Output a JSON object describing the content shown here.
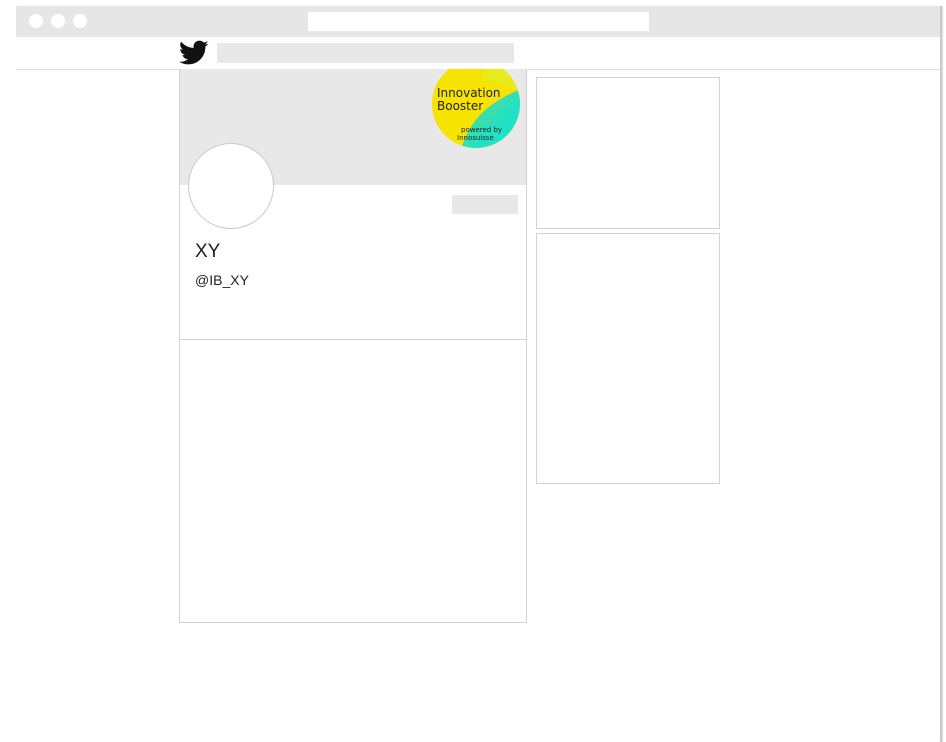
{
  "browser": {
    "window_controls": [
      "window-dot-1",
      "window-dot-2",
      "window-dot-3"
    ],
    "address_bar_value": ""
  },
  "topnav": {
    "logo_icon": "twitter-bird-icon",
    "search_value": ""
  },
  "profile": {
    "banner_badge": {
      "line1": "Innovation",
      "line2": "Booster",
      "powered_by": "powered by",
      "brand": "Innosuisse",
      "colors": {
        "yellow": "#f4e000",
        "cyan": "#1ee3c8",
        "green": "#5fd27a"
      }
    },
    "display_name": "XY",
    "handle": "@IB_XY",
    "follow_button_label": ""
  },
  "colors": {
    "chrome": "#e6e6e6",
    "placeholder": "#e8e8e8",
    "border": "#d2d2d2"
  }
}
